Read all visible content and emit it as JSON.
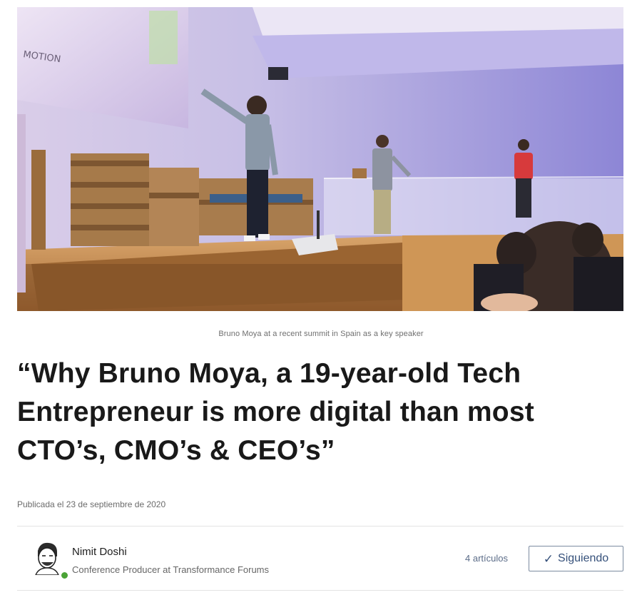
{
  "hero": {
    "image_name": "summit-stage-photo",
    "screen_text": "MOTION"
  },
  "caption": "Bruno Moya at a recent summit in Spain as a key speaker",
  "headline": "“Why Bruno Moya, a 19-year-old Tech Entrepreneur is more digital than most CTO’s, CMO’s & CEO’s”",
  "published": "Publicada el 23 de septiembre de 2020",
  "author": {
    "name": "Nimit Doshi",
    "title": "Conference Producer at Transformance Forums",
    "avatar_icon": "avatar",
    "online_color": "#4aa336"
  },
  "article_count": "4 artículos",
  "follow": {
    "icon": "check-icon",
    "label": "Siguiendo",
    "color": "#35507a"
  }
}
